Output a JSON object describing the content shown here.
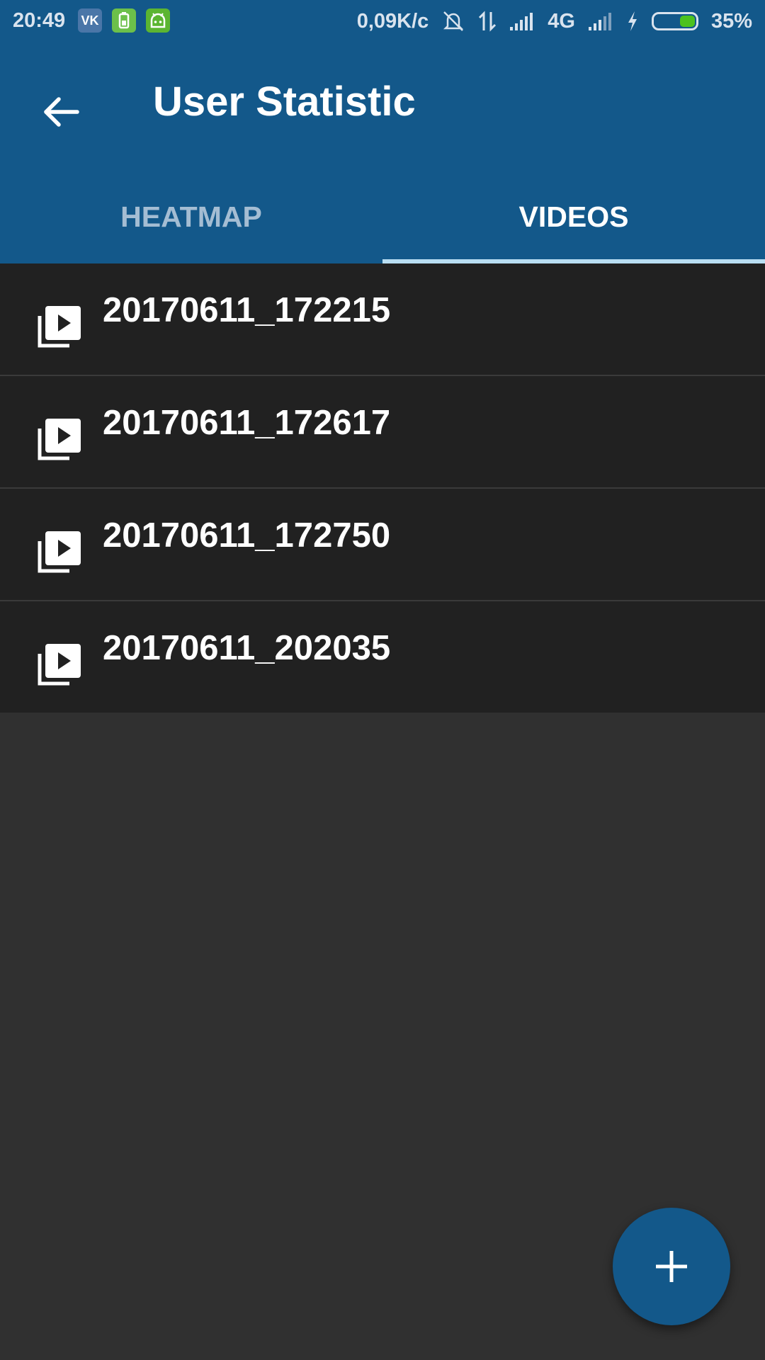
{
  "status_bar": {
    "time": "20:49",
    "apps": [
      {
        "label": "VK",
        "color": "#4a76a8"
      },
      {
        "label": "",
        "color": "#6cc04a"
      },
      {
        "label": "",
        "color": "#5cb531"
      }
    ],
    "network_speed": "0,09K/c",
    "network_type": "4G",
    "battery_percent": "35%",
    "battery_level": 0.35
  },
  "app_bar": {
    "title": "User Statistic",
    "back_icon": "arrow-left-icon"
  },
  "tabs": [
    {
      "label": "HEATMAP",
      "selected": false
    },
    {
      "label": "VIDEOS",
      "selected": true
    }
  ],
  "videos": [
    {
      "name": "20170611_172215",
      "icon": "video-library-icon"
    },
    {
      "name": "20170611_172617",
      "icon": "video-library-icon"
    },
    {
      "name": "20170611_172750",
      "icon": "video-library-icon"
    },
    {
      "name": "20170611_202035",
      "icon": "video-library-icon"
    }
  ],
  "fab": {
    "icon": "plus-icon"
  },
  "colors": {
    "primary": "#13588a",
    "list_background": "#212121",
    "page_background": "#303030",
    "tab_indicator": "#b9def2",
    "battery": "#4cc21f"
  }
}
